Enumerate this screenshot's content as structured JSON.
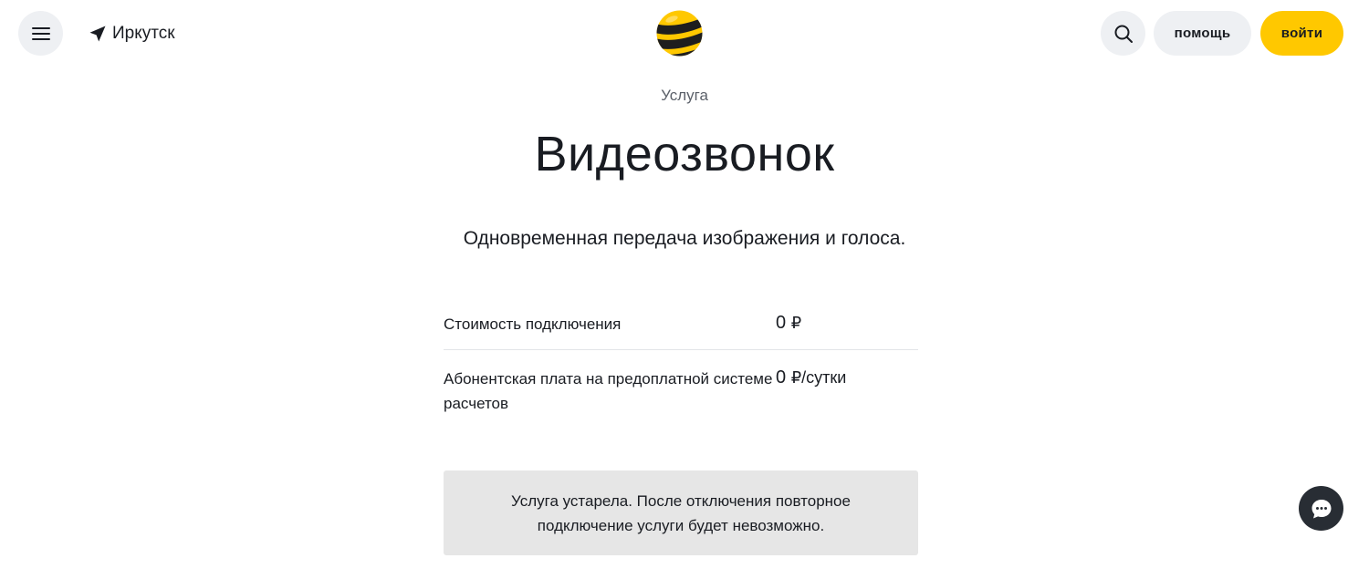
{
  "header": {
    "city": "Иркутск",
    "help_label": "помощь",
    "login_label": "войти",
    "icons": [
      "menu-icon",
      "location-arrow-icon",
      "beeline-logo",
      "search-icon",
      "chat-icon"
    ],
    "colors": {
      "accent": "#ffc800",
      "button_bg": "#eef0f3",
      "chat_bg": "#282d34"
    }
  },
  "service": {
    "eyebrow": "Услуга",
    "title": "Видеозвонок",
    "description": "Одновременная передача изображения и голоса."
  },
  "prices": [
    {
      "label": "Стоимость подключения",
      "amount": "0",
      "unit": "₽"
    },
    {
      "label": "Абонентская плата на предоплатной системе расчетов",
      "amount": "0",
      "unit": "₽/сутки"
    }
  ],
  "notice": {
    "text": "Услуга устарела. После отключения повторное подключение услуги будет невозможно.",
    "background": "#e6e6e6"
  }
}
